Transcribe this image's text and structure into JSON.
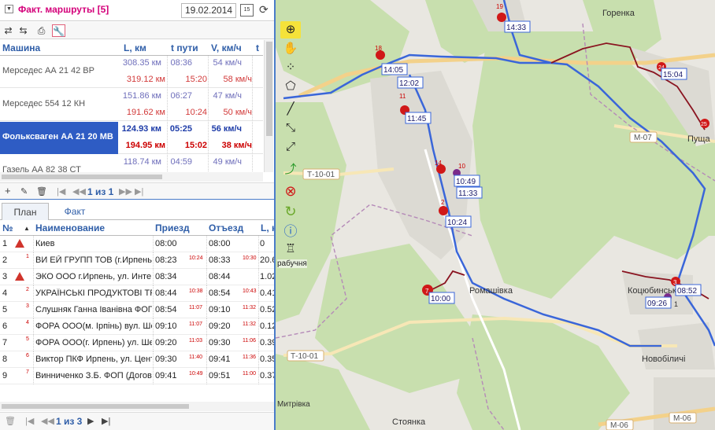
{
  "header": {
    "title": "Факт. маршруты [5]",
    "date": "19.02.2014",
    "calendar_day": "15"
  },
  "vehicles": {
    "columns": [
      "Машина",
      "L, км",
      "t пути",
      "V, км/ч",
      "t"
    ],
    "rows": [
      {
        "name": "Мерседес АА 21 42 ВР",
        "plan_l": "308.35 км",
        "plan_t": "08:36",
        "plan_v": "54 км/ч",
        "fact_l": "319.12 км",
        "fact_t": "15:20",
        "fact_v": "58 км/ч"
      },
      {
        "name": "Мерседес 554 12 КН",
        "plan_l": "151.86 км",
        "plan_t": "06:27",
        "plan_v": "47 км/ч",
        "fact_l": "191.62 км",
        "fact_t": "10:24",
        "fact_v": "50 км/ч"
      },
      {
        "name": "Фольксваген АА 21 20 МВ",
        "plan_l": "124.93 км",
        "plan_t": "05:25",
        "plan_v": "56 км/ч",
        "fact_l": "194.95 км",
        "fact_t": "15:02",
        "fact_v": "38 км/ч"
      },
      {
        "name": "Газель АА 82 38 СТ",
        "plan_l": "118.74 км",
        "plan_t": "04:59",
        "plan_v": "49 км/ч",
        "fact_l": "",
        "fact_t": "",
        "fact_v": ""
      }
    ],
    "pager": "1 из 1"
  },
  "tabs": {
    "plan": "План",
    "fact": "Факт"
  },
  "stops": {
    "columns": [
      "№",
      "Наименование",
      "Приезд",
      "Отъезд",
      "L, к"
    ],
    "rows": [
      {
        "n": "1",
        "warn": true,
        "idx": "",
        "name": "Киев",
        "arrive": "08:00",
        "arrive_fact": "",
        "depart": "08:00",
        "depart_fact": "",
        "l": "0"
      },
      {
        "n": "2",
        "warn": false,
        "idx": "1",
        "name": "ВИ ЕЙ ГРУПП ТОВ (г.Ирпень",
        "arrive": "08:23",
        "arrive_fact": "10:24",
        "depart": "08:33",
        "depart_fact": "10:30",
        "l": "20.6"
      },
      {
        "n": "3",
        "warn": true,
        "idx": "",
        "name": "ЭКО ООО г.Ирпень, ул. Инте",
        "arrive": "08:34",
        "arrive_fact": "",
        "depart": "08:44",
        "depart_fact": "",
        "l": "1.02"
      },
      {
        "n": "4",
        "warn": false,
        "idx": "2",
        "name": "УКРАЇНСЬКІ ПРОДУКТОВІ ТРА",
        "arrive": "08:44",
        "arrive_fact": "10:38",
        "depart": "08:54",
        "depart_fact": "10:43",
        "l": "0.41"
      },
      {
        "n": "5",
        "warn": false,
        "idx": "3",
        "name": "Слушняк Ганна Іванівна ФОП",
        "arrive": "08:54",
        "arrive_fact": "11:07",
        "depart": "09:10",
        "depart_fact": "11:32",
        "l": "0.52"
      },
      {
        "n": "6",
        "warn": false,
        "idx": "4",
        "name": "ФОРА ООО(м. Ірпінь) вул. Ше",
        "arrive": "09:10",
        "arrive_fact": "11:07",
        "depart": "09:20",
        "depart_fact": "11:32",
        "l": "0.12"
      },
      {
        "n": "7",
        "warn": false,
        "idx": "5",
        "name": "ФОРА ООО(г. Ирпень) ул. Ше",
        "arrive": "09:20",
        "arrive_fact": "11:03",
        "depart": "09:30",
        "depart_fact": "11:06",
        "l": "0.39"
      },
      {
        "n": "8",
        "warn": false,
        "idx": "6",
        "name": "Виктор ПКФ Ирпень, ул. Цент",
        "arrive": "09:30",
        "arrive_fact": "11:40",
        "depart": "09:41",
        "depart_fact": "11:36",
        "l": "0.35"
      },
      {
        "n": "9",
        "warn": false,
        "idx": "7",
        "name": "Винниченко З.Б. ФОП (Догов",
        "arrive": "09:41",
        "arrive_fact": "10:49",
        "depart": "09:51",
        "depart_fact": "11:00",
        "l": "0.37"
      }
    ],
    "pager": "1 из 3"
  },
  "map": {
    "tool_label": "рабучня",
    "places": [
      "Горенка",
      "Пуща",
      "Ромашівка",
      "Коцюбинське",
      "Новобіличі",
      "Стоянка",
      "Митрівка"
    ],
    "roads": [
      "Т-10-01",
      "Т-10-01",
      "М-07",
      "М-06",
      "М-06"
    ],
    "time_labels": [
      "14:33",
      "14:05",
      "12:02",
      "11:45",
      "15:04",
      "10:49",
      "11:33",
      "10:24",
      "10:00",
      "08:52",
      "09:26"
    ],
    "marker_numbers": [
      "19",
      "18",
      "11",
      "24",
      "25",
      "14",
      "10",
      "2",
      "7",
      "3",
      "1"
    ]
  }
}
